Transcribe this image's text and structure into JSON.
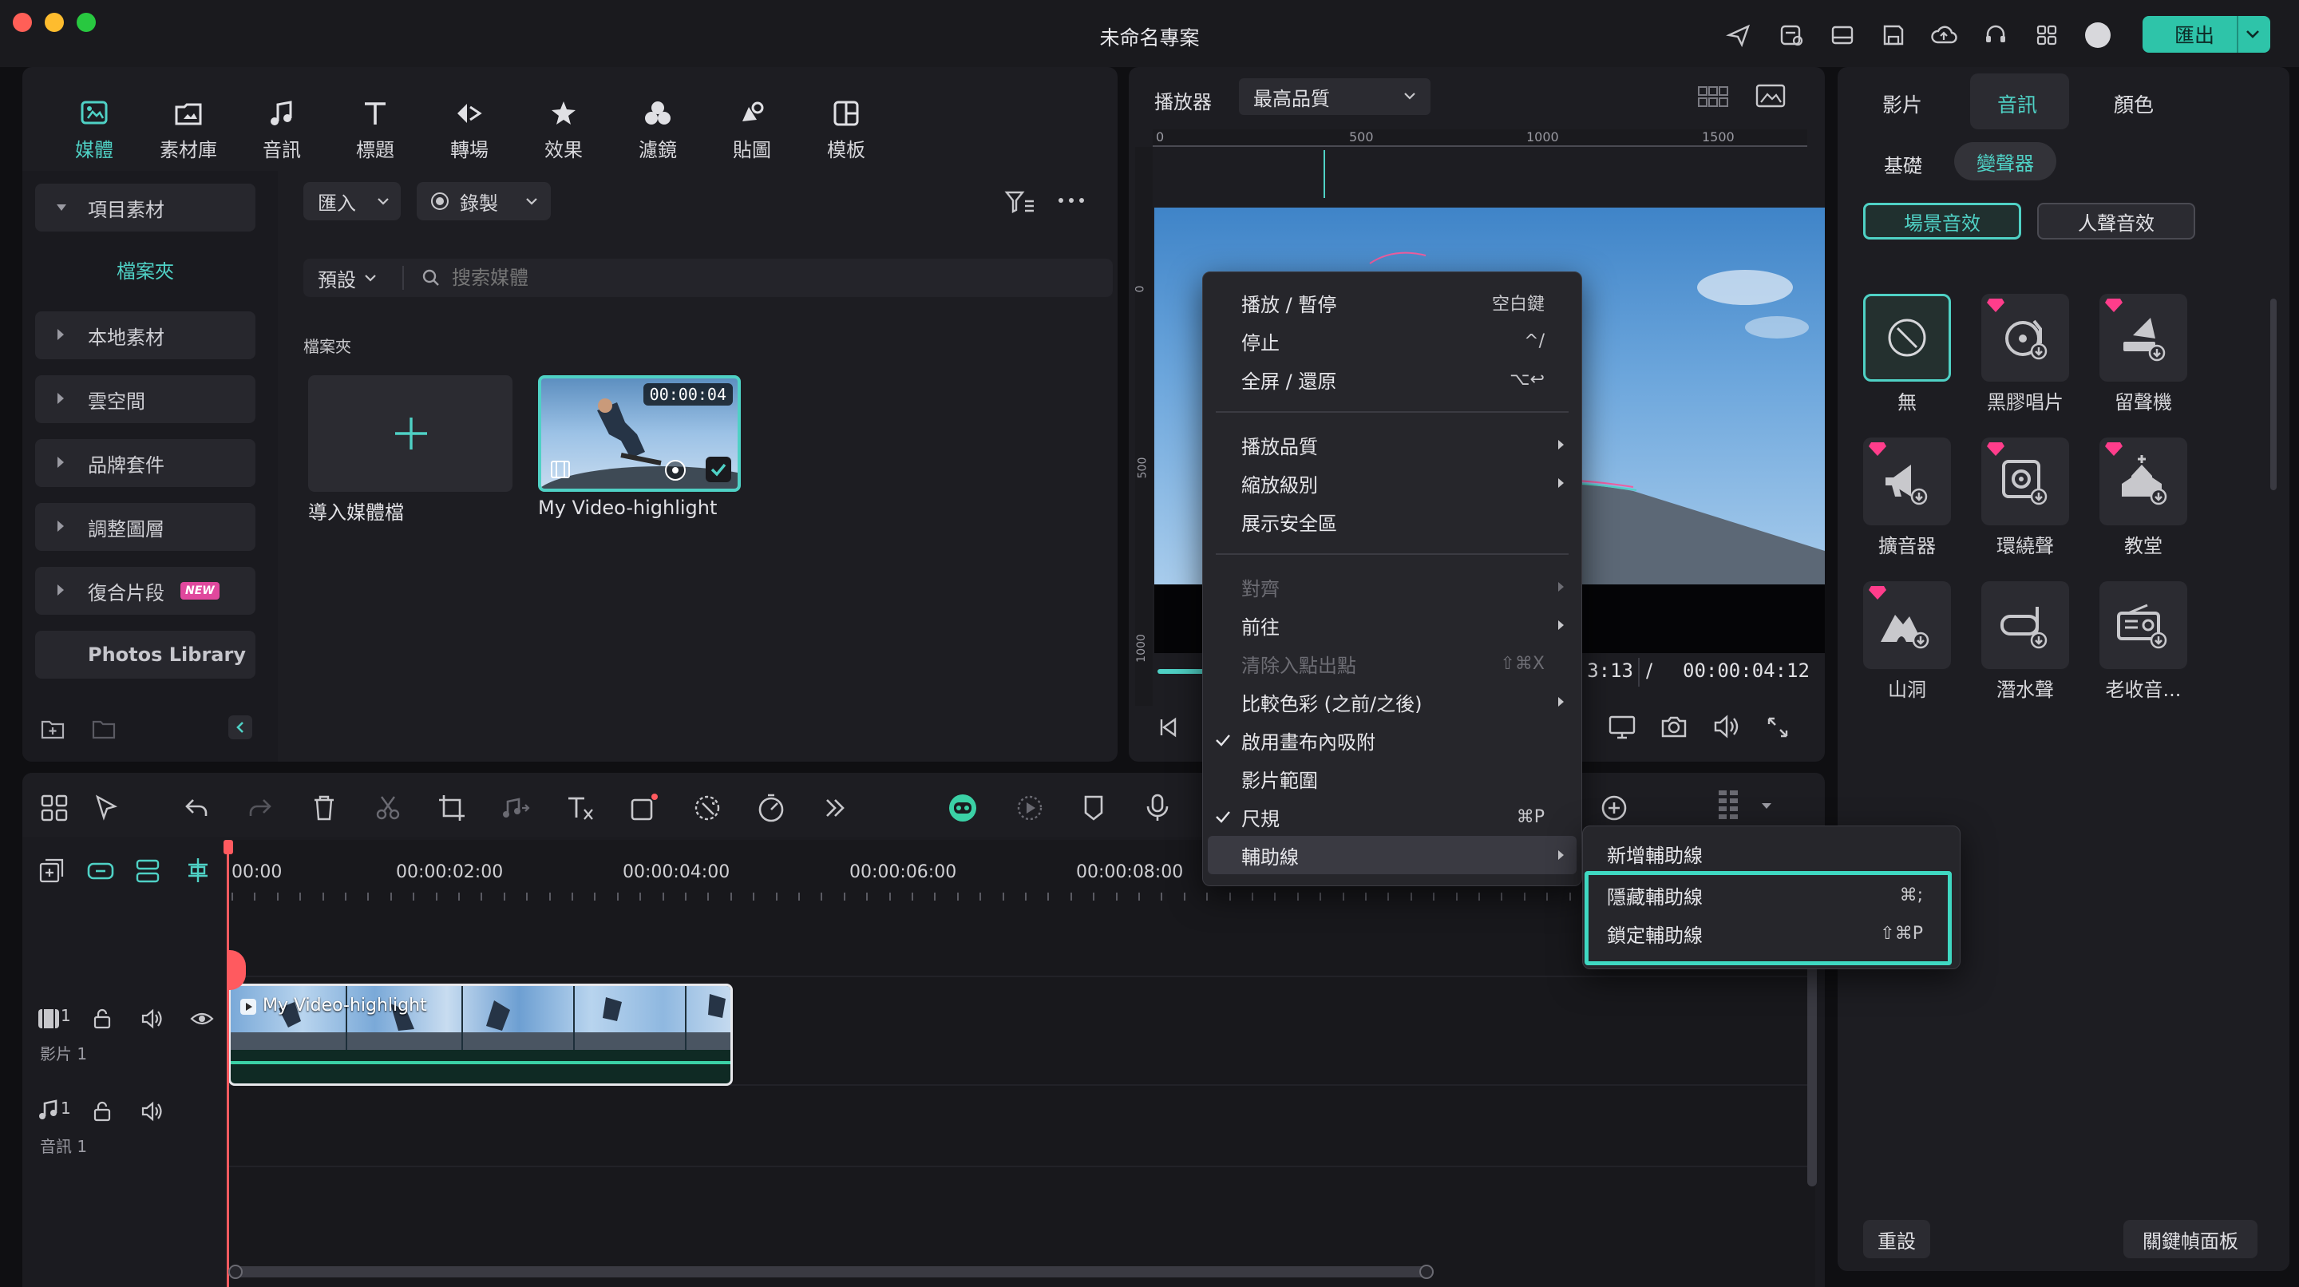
{
  "window": {
    "title": "未命名專案",
    "export_label": "匯出"
  },
  "nav": {
    "items": [
      {
        "label": "媒體",
        "icon": "media-icon"
      },
      {
        "label": "素材庫",
        "icon": "stock-icon"
      },
      {
        "label": "音訊",
        "icon": "music-note-icon"
      },
      {
        "label": "標題",
        "icon": "title-t-icon"
      },
      {
        "label": "轉場",
        "icon": "transition-icon"
      },
      {
        "label": "效果",
        "icon": "effects-star-icon"
      },
      {
        "label": "濾鏡",
        "icon": "filters-icon"
      },
      {
        "label": "貼圖",
        "icon": "stickers-icon"
      },
      {
        "label": "模板",
        "icon": "templates-icon"
      }
    ]
  },
  "sidebar": {
    "project_media": "項目素材",
    "folder": "檔案夾",
    "items": [
      "本地素材",
      "雲空間",
      "品牌套件",
      "調整圖層",
      "復合片段"
    ],
    "new_badge": "NEW",
    "photos_library": "Photos Library"
  },
  "media": {
    "import_label": "匯入",
    "record_label": "錄製",
    "preset_label": "預設",
    "search_placeholder": "搜索媒體",
    "section_label": "檔案夾",
    "import_tile_label": "導入媒體檔",
    "clip": {
      "name": "My Video-highlight",
      "duration": "00:00:04"
    }
  },
  "player": {
    "label": "播放器",
    "quality": "最高品質",
    "ruler_top": [
      "0",
      "500",
      "1000",
      "1500"
    ],
    "ruler_left": [
      "0",
      "500",
      "1000"
    ],
    "current_time": "00:00:03:13",
    "current_time_visible": "3:13",
    "separator": "/",
    "total_time": "00:00:04:12"
  },
  "context_menu": {
    "items": [
      {
        "label": "播放 / 暫停",
        "shortcut": "空白鍵"
      },
      {
        "label": "停止",
        "shortcut": "^/"
      },
      {
        "label": "全屏 / 還原",
        "shortcut": "⌥↩"
      },
      {
        "label": "播放品質",
        "submenu": true
      },
      {
        "label": "縮放級別",
        "submenu": true
      },
      {
        "label": "展示安全區"
      },
      {
        "label": "對齊",
        "submenu": true,
        "disabled": true
      },
      {
        "label": "前往",
        "submenu": true
      },
      {
        "label": "清除入點出點",
        "shortcut": "⇧⌘X",
        "disabled": true
      },
      {
        "label": "比較色彩 (之前/之後)",
        "submenu": true
      },
      {
        "label": "啟用畫布內吸附",
        "checked": true
      },
      {
        "label": "影片範圍"
      },
      {
        "label": "尺規",
        "shortcut": "⌘P",
        "checked": true
      },
      {
        "label": "輔助線",
        "submenu": true,
        "highlighted": true
      }
    ],
    "submenu": [
      {
        "label": "新增輔助線"
      },
      {
        "label": "隱藏輔助線",
        "shortcut": "⌘;"
      },
      {
        "label": "鎖定輔助線",
        "shortcut": "⇧⌘P"
      }
    ]
  },
  "right_panel": {
    "tabs": [
      "影片",
      "音訊",
      "顏色"
    ],
    "subtabs": [
      "基礎",
      "變聲器"
    ],
    "categories": [
      "場景音效",
      "人聲音效"
    ],
    "effects": [
      "無",
      "黑膠唱片",
      "留聲機",
      "擴音器",
      "環繞聲",
      "教堂",
      "山洞",
      "潛水聲",
      "老收音..."
    ],
    "reset_label": "重設",
    "keyframe_label": "關鍵幀面板"
  },
  "timeline": {
    "ruler": [
      "00:00",
      "00:00:02:00",
      "00:00:04:00",
      "00:00:06:00",
      "00:00:08:00"
    ],
    "video_track": {
      "number": "1",
      "label": "影片 1"
    },
    "audio_track": {
      "number": "1",
      "label": "音訊 1"
    },
    "clip_name": "My Video-highlight"
  },
  "colors": {
    "accent": "#4fd1c5",
    "playhead": "#ff5a5f",
    "panel": "#1d1d22",
    "background": "#0f0f12"
  }
}
